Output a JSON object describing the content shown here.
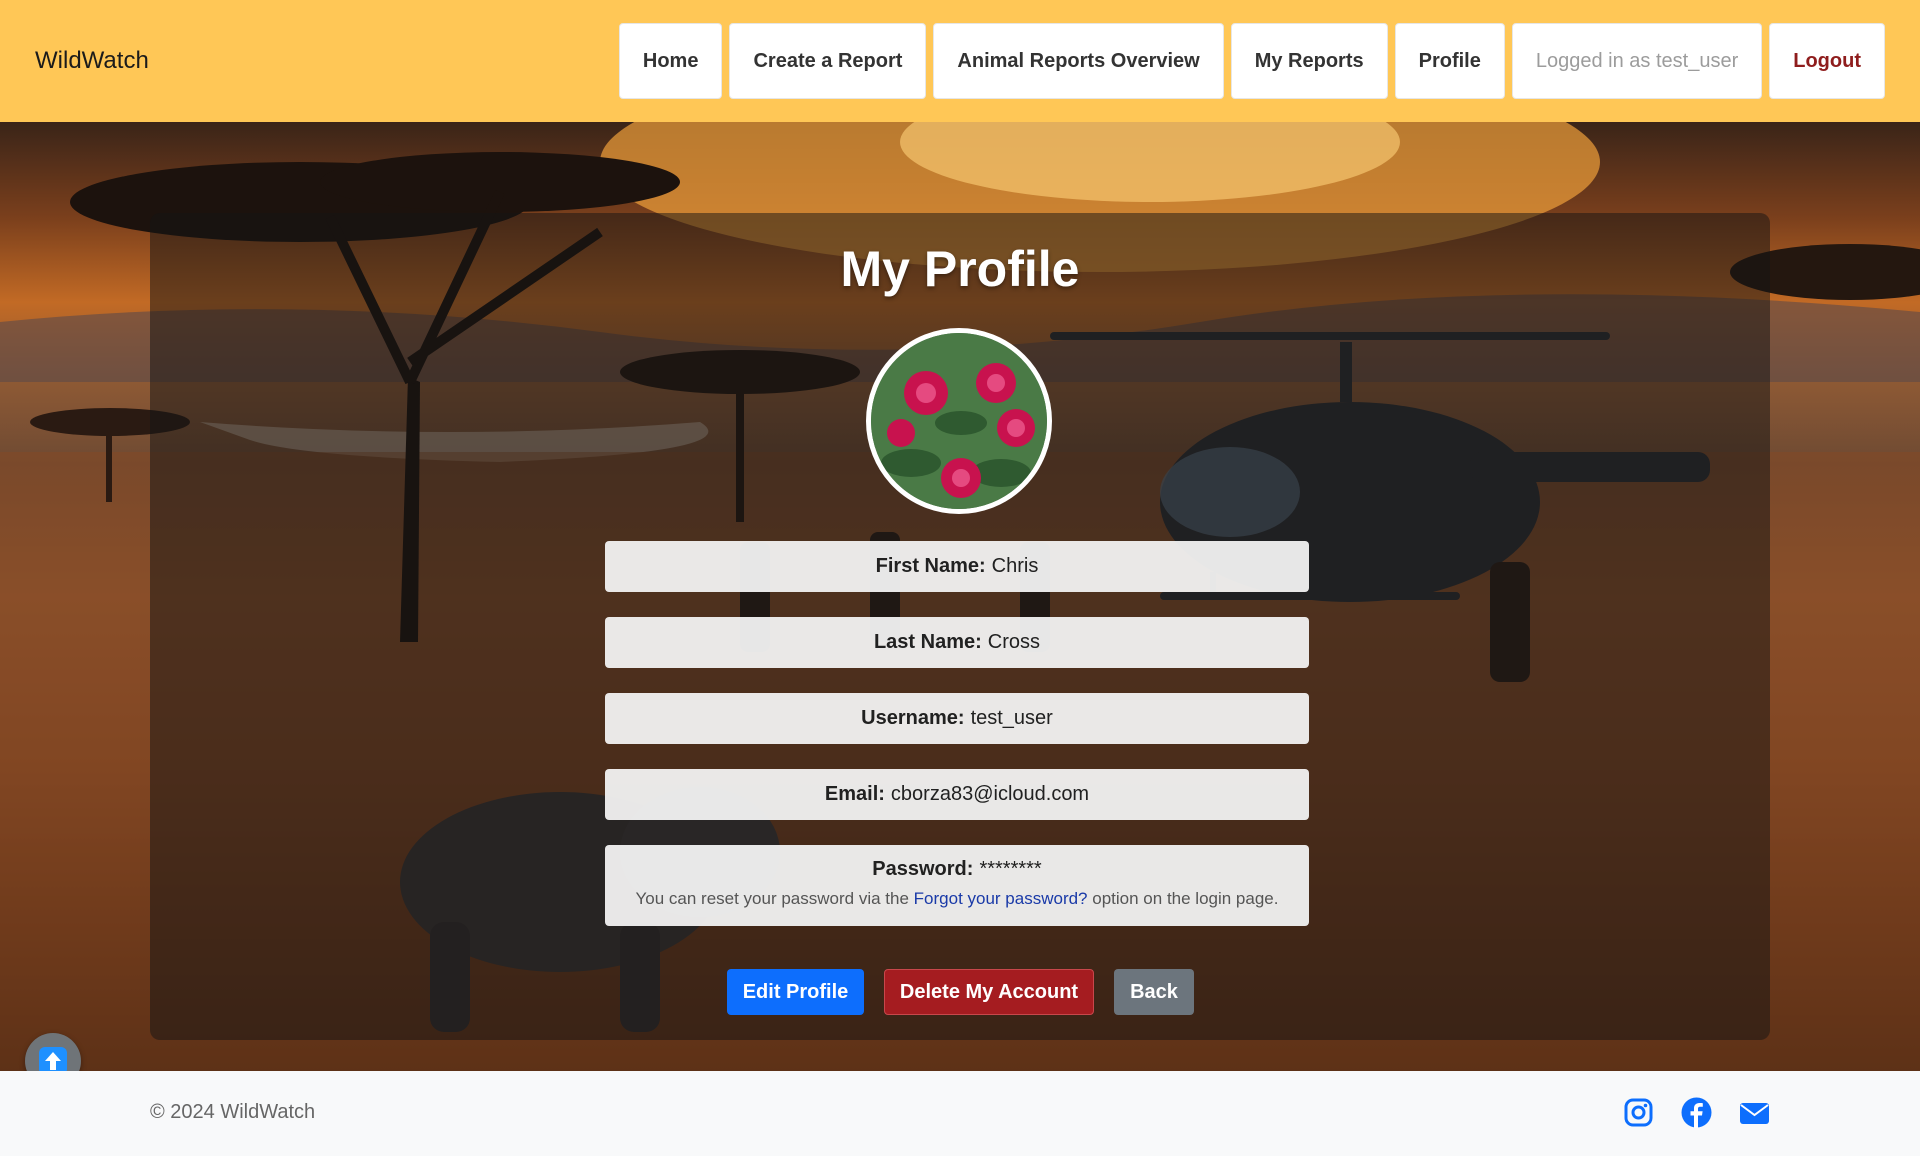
{
  "header": {
    "brand": "WildWatch",
    "nav": {
      "home": "Home",
      "create_report": "Create a Report",
      "animal_reports_overview": "Animal Reports Overview",
      "my_reports": "My Reports",
      "profile": "Profile",
      "logged_in_as": "Logged in as test_user",
      "logout": "Logout"
    }
  },
  "profile": {
    "title": "My Profile",
    "avatar_icon": "flower-avatar-image",
    "fields": {
      "first_name": {
        "label": "First Name:",
        "value": "Chris"
      },
      "last_name": {
        "label": "Last Name:",
        "value": "Cross"
      },
      "username": {
        "label": "Username:",
        "value": "test_user"
      },
      "email": {
        "label": "Email:",
        "value": "cborza83@icloud.com"
      },
      "password": {
        "label": "Password:",
        "value": "********"
      }
    },
    "password_note": {
      "before": "You can reset your password via the",
      "link": "Forgot your password?",
      "after": "option on the login page."
    },
    "buttons": {
      "edit": "Edit Profile",
      "delete": "Delete My Account",
      "back": "Back"
    }
  },
  "footer": {
    "copyright": "© 2024 WildWatch",
    "social_icons": [
      "instagram-icon",
      "facebook-icon",
      "envelope-icon"
    ]
  },
  "colors": {
    "navbar": "#ffc756",
    "primary": "#0d6efd",
    "danger": "#a51c20",
    "secondary": "#6c757d",
    "logout_text": "#8f1d1d",
    "link": "#1a3aa8"
  }
}
